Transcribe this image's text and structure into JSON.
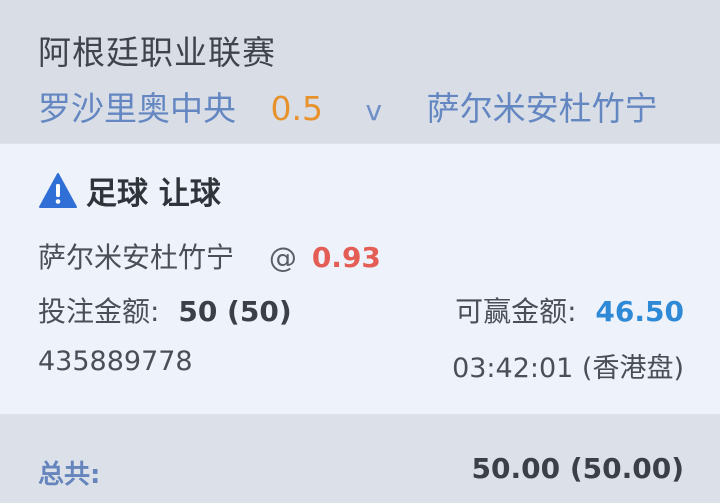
{
  "header": {
    "league": "阿根廷职业联赛",
    "home_team": "罗沙里奥中央",
    "handicap": "0.5",
    "vs": "v",
    "away_team": "萨尔米安杜竹宁"
  },
  "bet": {
    "icon": "warning-icon",
    "title": "足球 让球",
    "selection": "萨尔米安杜竹宁",
    "at": "@",
    "odds": "0.93",
    "stake_label": "投注金额:",
    "stake_value": "50 (50)",
    "payout_label": "可赢金额:",
    "payout_value": "46.50",
    "bet_id": "435889778",
    "bet_time": "03:42:01 (香港盘)"
  },
  "footer": {
    "total_label": "总共:",
    "total_value": "50.00 (50.00)"
  },
  "colors": {
    "accent_blue": "#2e8ad6",
    "odds_red": "#e45e55",
    "handicap_orange": "#e8922e",
    "team_blue": "#6487c2",
    "warning_blue": "#2f6fd6"
  }
}
